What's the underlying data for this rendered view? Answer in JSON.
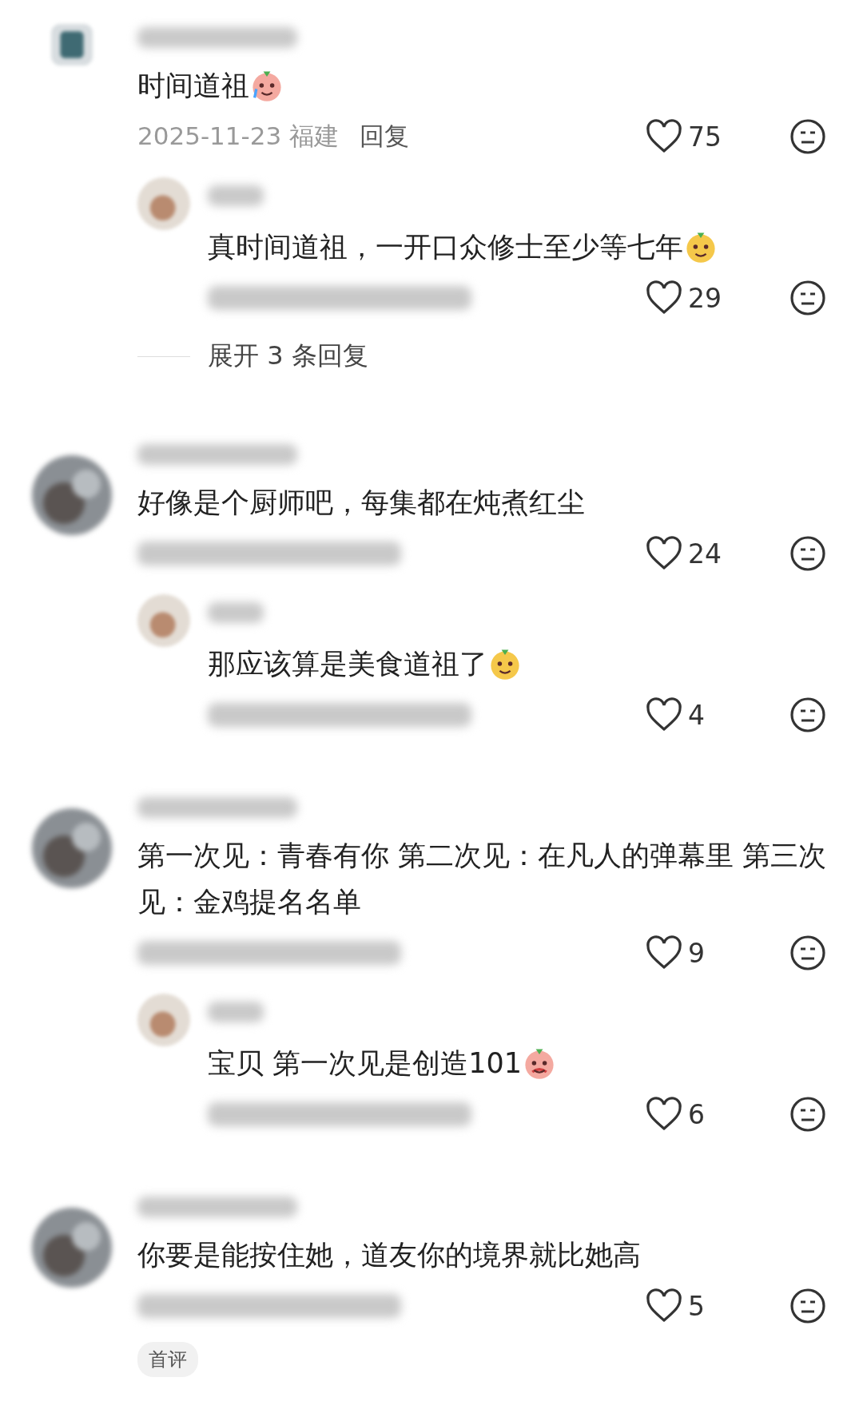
{
  "comments": [
    {
      "avatar": {
        "kind": "square"
      },
      "text": "时间道祖",
      "sticker": {
        "kind": "crying"
      },
      "date": "2025-11-23 福建",
      "reply_label": "回复",
      "likes": "75",
      "replies": [
        {
          "text": "真时间道祖，一开口众修士至少等七年",
          "sticker": {
            "kind": "dog"
          },
          "likes": "29"
        }
      ],
      "expand": "展开 3 条回复"
    },
    {
      "avatar": {
        "kind": "round"
      },
      "text": "好像是个厨师吧，每集都在炖煮红尘",
      "likes": "24",
      "replies": [
        {
          "text": "那应该算是美食道祖了",
          "sticker": {
            "kind": "dog"
          },
          "likes": "4"
        }
      ]
    },
    {
      "avatar": {
        "kind": "round"
      },
      "text": "第一次见：青春有你  第二次见：在凡人的弹幕里 第三次见：金鸡提名名单",
      "likes": "9",
      "replies": [
        {
          "text": "宝贝 第一次见是创造101",
          "sticker": {
            "kind": "blush"
          },
          "likes": "6"
        }
      ]
    },
    {
      "avatar": {
        "kind": "round"
      },
      "text": "你要是能按住她，道友你的境界就比她高",
      "likes": "5",
      "tag": "首评"
    }
  ]
}
